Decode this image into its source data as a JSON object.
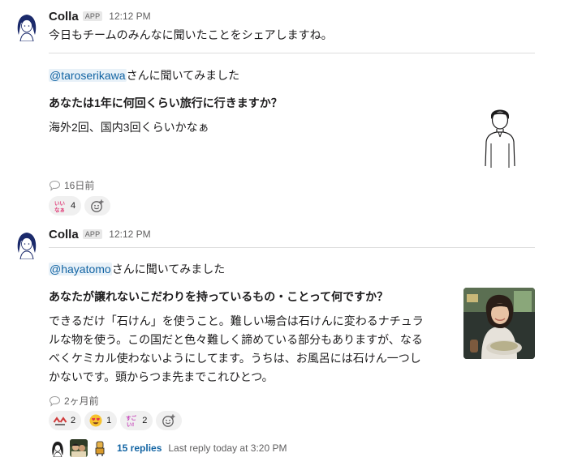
{
  "messages": [
    {
      "sender": "Colla",
      "badge": "APP",
      "time": "12:12 PM",
      "intro": "今日もチームのみんなに聞いたことをシェアしますね。",
      "mention": "@taroserikawa",
      "mention_suffix": "さんに聞いてみました",
      "question": "あなたは1年に何回くらい旅行に行きますか？",
      "answer": "海外2回、国内3回くらいかなぁ",
      "age": "16日前",
      "reactions": [
        {
          "emoji": "iinaa-icon",
          "count": "4"
        }
      ]
    },
    {
      "sender": "Colla",
      "badge": "APP",
      "time": "12:12 PM",
      "mention": "@hayatomo",
      "mention_suffix": "さんに聞いてみました",
      "question": "あなたが譲れないこだわりを持っているもの・ことって何ですか？",
      "answer_lines": [
        "できるだけ「石けん」を使うこと。難しい場合は石けんに変わるナチュラ",
        "ルな物を使う。この国だと色々難しく諦めている部分もありますが、なる",
        "べくケミカル使わないようにしてます。うちは、お風呂には石けん一つし",
        "かないです。頭からつま先までこれひとつ。"
      ],
      "age": "2ヶ月前",
      "reactions": [
        {
          "emoji": "arrow-mark-icon",
          "count": "2"
        },
        {
          "emoji": "heart-eyes-icon",
          "count": "1"
        },
        {
          "emoji": "sugoi-icon",
          "count": "2"
        }
      ],
      "thread": {
        "replies": "15 replies",
        "last_reply": "Last reply today at 3:20 PM"
      }
    }
  ]
}
